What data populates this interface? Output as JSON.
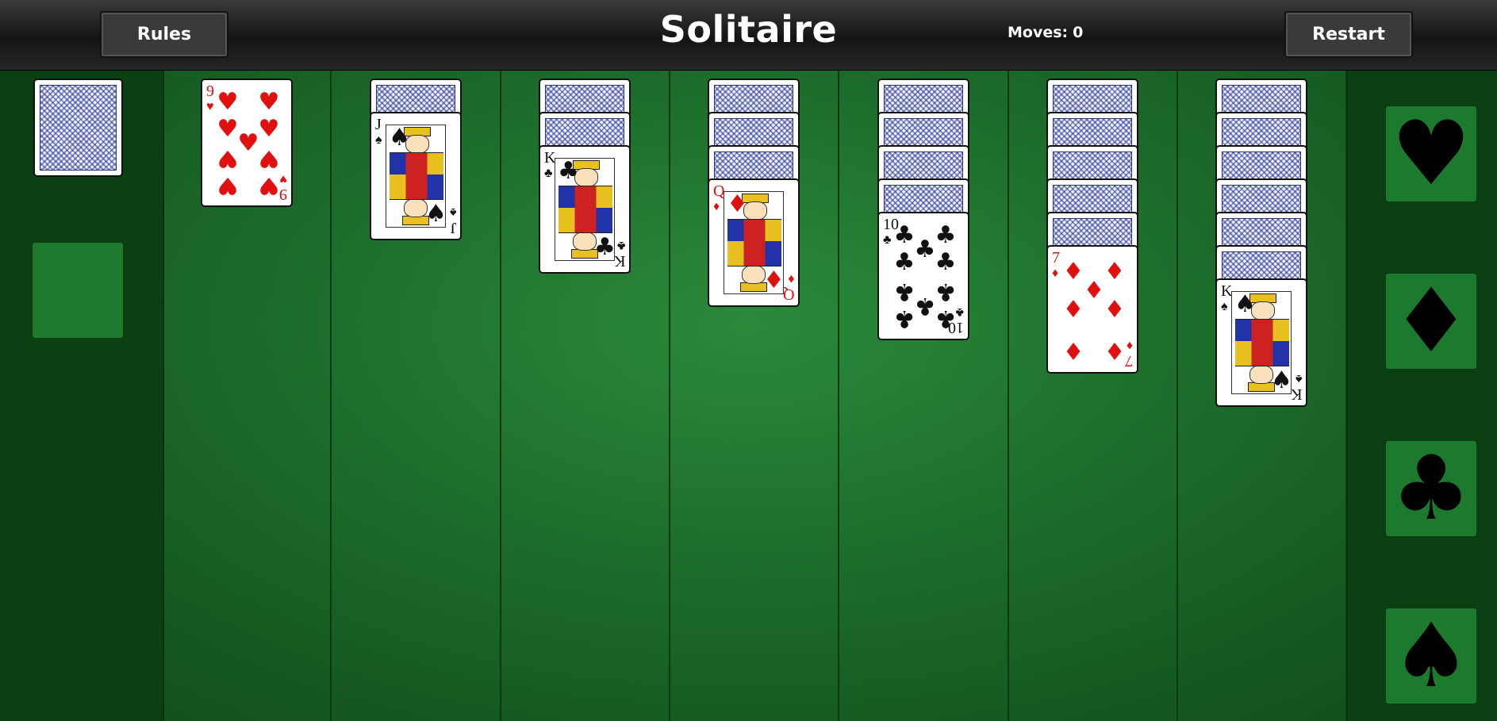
{
  "header": {
    "title": "Solitaire",
    "moves_label": "Moves:",
    "moves_value": "0",
    "rules_label": "Rules",
    "restart_label": "Restart"
  },
  "colors": {
    "felt": "#1c6b2a",
    "felt_dark": "#0a4012",
    "red_suit": "#e01010",
    "card_back": "#2a3296"
  },
  "stock": {
    "face_down": true
  },
  "waste": {
    "empty": true
  },
  "tableau": [
    {
      "hidden": 0,
      "top": {
        "rank": "9",
        "suit": "hearts",
        "symbol": "♥",
        "color": "red"
      }
    },
    {
      "hidden": 1,
      "top": {
        "rank": "J",
        "suit": "spades",
        "symbol": "♠",
        "color": "black"
      }
    },
    {
      "hidden": 2,
      "top": {
        "rank": "K",
        "suit": "clubs",
        "symbol": "♣",
        "color": "black"
      }
    },
    {
      "hidden": 3,
      "top": {
        "rank": "Q",
        "suit": "diamonds",
        "symbol": "♦",
        "color": "red"
      }
    },
    {
      "hidden": 4,
      "top": {
        "rank": "10",
        "suit": "clubs",
        "symbol": "♣",
        "color": "black"
      }
    },
    {
      "hidden": 5,
      "top": {
        "rank": "7",
        "suit": "diamonds",
        "symbol": "♦",
        "color": "red"
      }
    },
    {
      "hidden": 6,
      "top": {
        "rank": "K",
        "suit": "spades",
        "symbol": "♠",
        "color": "black"
      }
    }
  ],
  "foundations": [
    {
      "suit": "hearts",
      "symbol": "♥"
    },
    {
      "suit": "diamonds",
      "symbol": "♦"
    },
    {
      "suit": "clubs",
      "symbol": "♣"
    },
    {
      "suit": "spades",
      "symbol": "♠"
    }
  ]
}
